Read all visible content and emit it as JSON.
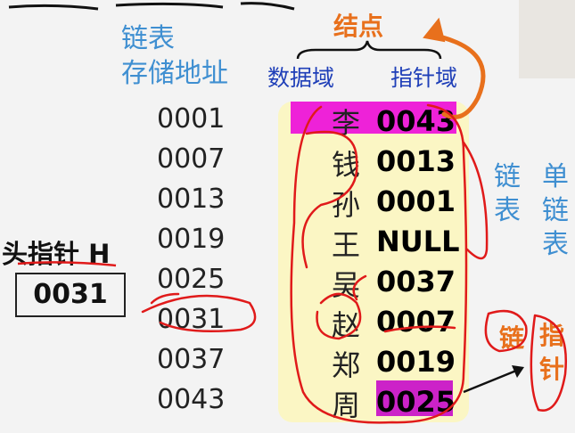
{
  "header": {
    "storage_line1": "链表",
    "storage_line2": "存储地址",
    "node_label": "结点",
    "data_field_label": "数据域",
    "pointer_field_label": "指针域"
  },
  "rows": [
    {
      "address": "0001",
      "data": "李",
      "pointer": "0043"
    },
    {
      "address": "0007",
      "data": "钱",
      "pointer": "0013"
    },
    {
      "address": "0013",
      "data": "孙",
      "pointer": "0001"
    },
    {
      "address": "0019",
      "data": "王",
      "pointer": "NULL"
    },
    {
      "address": "0025",
      "data": "吴",
      "pointer": "0037"
    },
    {
      "address": "0031",
      "data": "赵",
      "pointer": "0007"
    },
    {
      "address": "0037",
      "data": "郑",
      "pointer": "0019"
    },
    {
      "address": "0043",
      "data": "周",
      "pointer": "0025"
    }
  ],
  "head_pointer": {
    "label": "头指针 H",
    "value": "0031"
  },
  "side_labels": {
    "linked_list": [
      "链",
      "表"
    ],
    "single_linked_list": [
      "单",
      "链",
      "表"
    ],
    "link": "链",
    "pointer": [
      "指",
      "针"
    ]
  },
  "colors": {
    "highlight_magenta": "#ee22d8",
    "annotation_red": "#e01a1a",
    "label_orange": "#e8701c",
    "label_blue": "#3f8fd1",
    "field_navy": "#1f3fb8",
    "table_bg": "#fbf6c4"
  }
}
